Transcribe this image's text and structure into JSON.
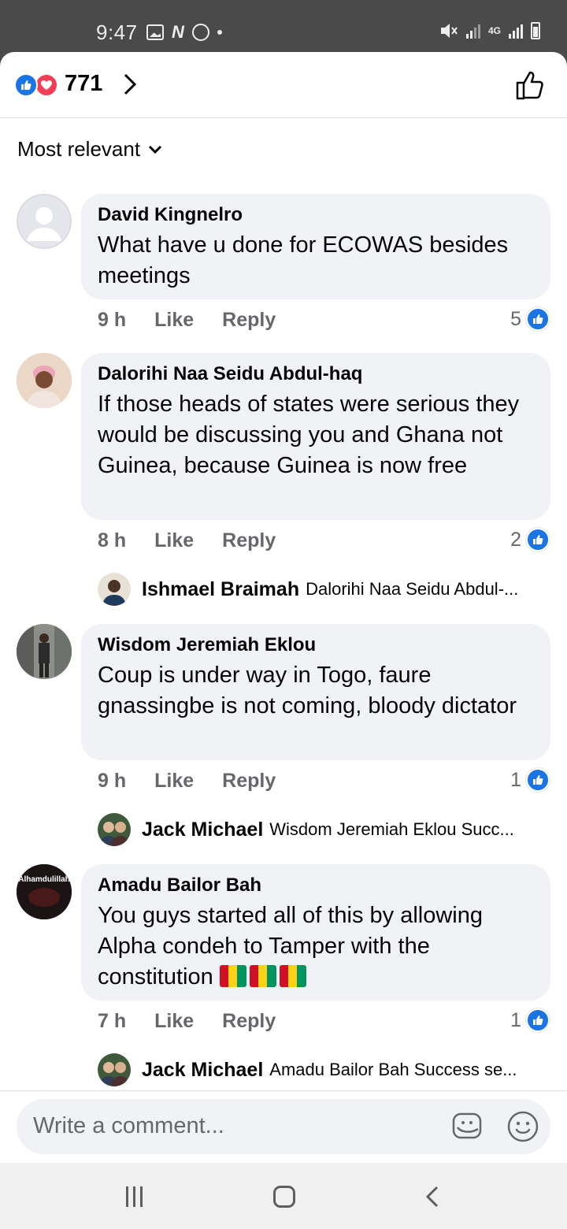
{
  "status_bar": {
    "time": "9:47",
    "network": "4G"
  },
  "reactions": {
    "count": "771"
  },
  "sort": {
    "label": "Most relevant"
  },
  "comments": [
    {
      "author": "David Kingnelro",
      "text": "What have u done for ECOWAS besides meetings",
      "time": "9 h",
      "like_label": "Like",
      "reply_label": "Reply",
      "reaction_count": "5"
    },
    {
      "author": "Dalorihi Naa Seidu Abdul-haq",
      "text": "If those heads of states were serious they would be discussing you and Ghana not Guinea, because Guinea is now free",
      "time": "8 h",
      "like_label": "Like",
      "reply_label": "Reply",
      "reaction_count": "2",
      "reply_preview": {
        "author": "Ishmael Braimah",
        "text": "Dalorihi Naa Seidu Abdul-..."
      }
    },
    {
      "author": "Wisdom Jeremiah Eklou",
      "text": "Coup is under way in Togo, faure gnassingbe is not coming, bloody dictator",
      "time": "9 h",
      "like_label": "Like",
      "reply_label": "Reply",
      "reaction_count": "1",
      "reply_preview": {
        "author": "Jack Michael",
        "text": "Wisdom Jeremiah Eklou Succ..."
      }
    },
    {
      "author": "Amadu Bailor Bah",
      "text": "You guys started all of this by allowing Alpha condeh to Tamper with the constitution",
      "time": "7 h",
      "like_label": "Like",
      "reply_label": "Reply",
      "reaction_count": "1",
      "avatar_text": "Alhamdulillah",
      "reply_preview": {
        "author": "Jack Michael",
        "text": "Amadu Bailor Bah Success se..."
      }
    }
  ],
  "composer": {
    "placeholder": "Write a comment..."
  },
  "colors": {
    "accent": "#1b74e4",
    "love": "#f33e58",
    "bubble": "#f0f2f5",
    "meta": "#65676b"
  },
  "icons": [
    "like-reaction-icon",
    "love-reaction-icon",
    "chevron-right-icon",
    "thumbs-up-icon",
    "chevron-down-icon",
    "gif-sticker-icon",
    "emoji-icon"
  ]
}
